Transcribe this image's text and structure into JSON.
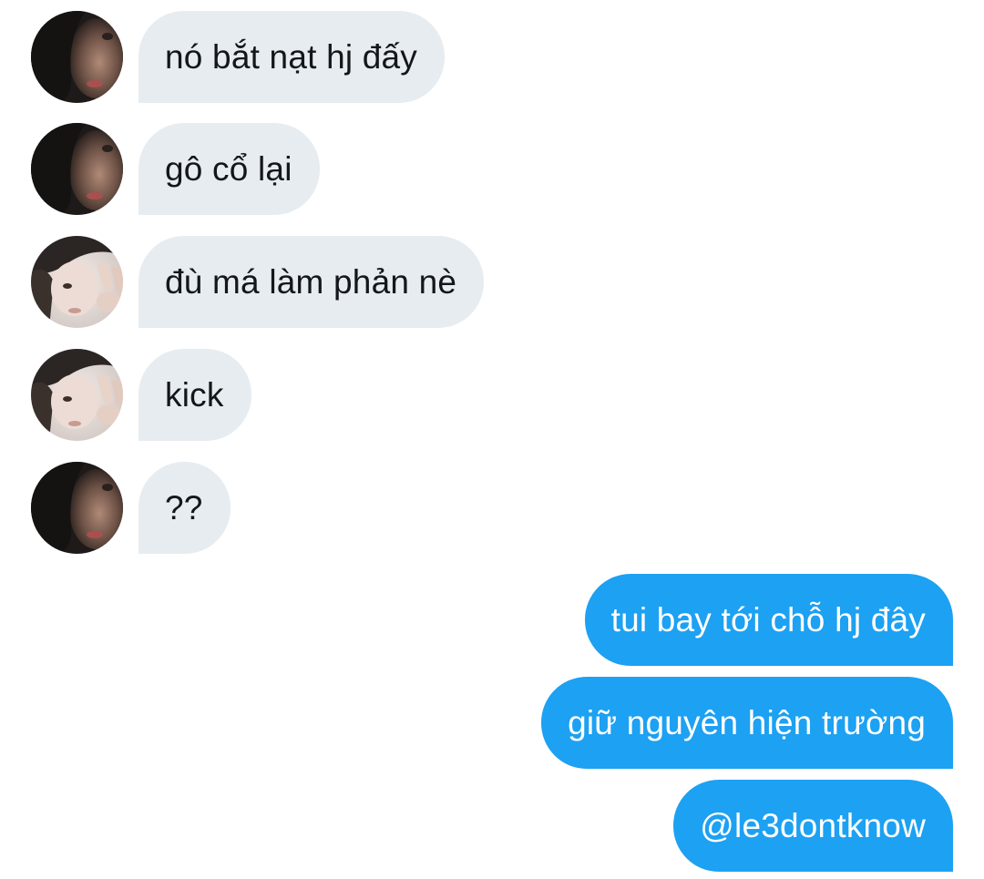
{
  "conversation": {
    "messages": [
      {
        "text": "nó bắt nạt hj đấy",
        "avatar": "dark-hood-avatar"
      },
      {
        "text": "gô cổ lại",
        "avatar": "dark-hood-avatar"
      },
      {
        "text": "đù má làm phản nè",
        "avatar": "peace-sign-avatar"
      },
      {
        "text": "kick",
        "avatar": "peace-sign-avatar"
      },
      {
        "text": "??",
        "avatar": "dark-hood-avatar"
      },
      {
        "text": "tui bay tới chỗ hj đây"
      },
      {
        "text": "giữ nguyên hiện trường"
      },
      {
        "text": "@le3dontknow"
      }
    ]
  },
  "colors": {
    "incoming_bubble": "#e7ecf0",
    "incoming_text": "#14171a",
    "outgoing_bubble": "#1da1f2",
    "outgoing_text": "#ffffff"
  }
}
